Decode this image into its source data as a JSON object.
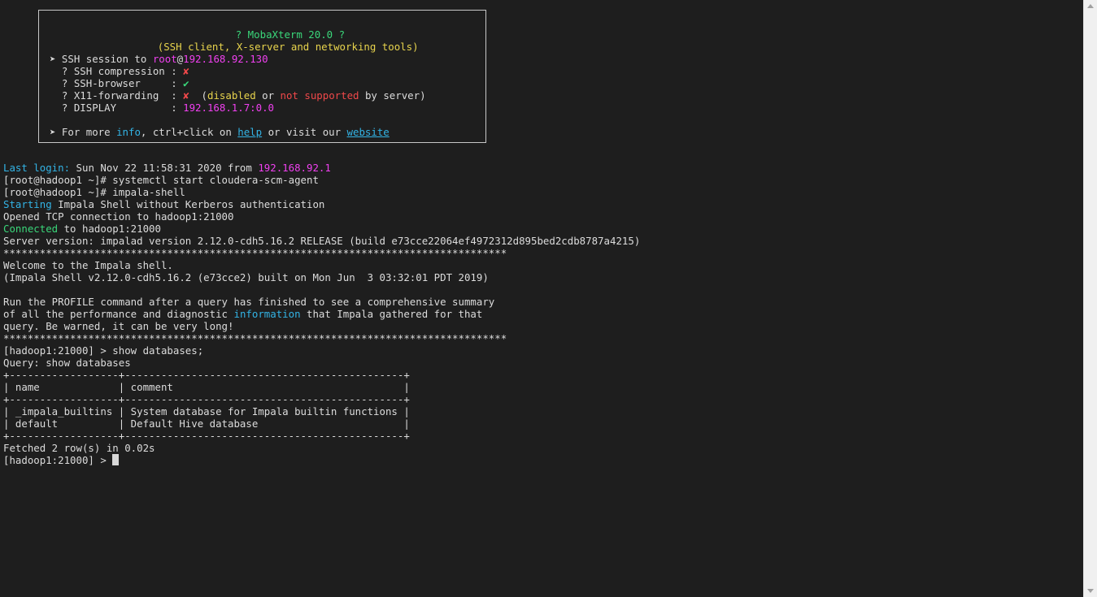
{
  "banner": {
    "title": "? MobaXterm 20.0 ?",
    "subtitle": "(SSH client, X-server and networking tools)",
    "session_prefix": "➤ SSH session to ",
    "session_user": "root",
    "session_at": "@",
    "session_host": "192.168.92.130",
    "compression_label": "  ? SSH compression : ",
    "compression_status": "✘",
    "browser_label": "  ? SSH-browser     : ",
    "browser_status": "✔",
    "x11_label": "  ? X11-forwarding  : ",
    "x11_status": "✘",
    "x11_open": "  (",
    "x11_disabled": "disabled",
    "x11_or": " or ",
    "x11_not_supported": "not supported",
    "x11_close": " by server)",
    "display_label": "  ? DISPLAY         : ",
    "display_value": "192.168.1.7:0.0",
    "more_prefix": "➤ For more ",
    "more_info": "info",
    "more_mid": ", ctrl+click on ",
    "more_help": "help",
    "more_visit": " or visit our ",
    "more_website": "website"
  },
  "terminal": {
    "last_login_label": "Last login:",
    "last_login_date": " Sun Nov 22 11:58:31 2020 from ",
    "last_login_ip": "192.168.92.1",
    "cmd1": "[root@hadoop1 ~]# systemctl start cloudera-scm-agent",
    "cmd2": "[root@hadoop1 ~]# impala-shell",
    "starting_word": "Starting",
    "starting_rest": " Impala Shell without Kerberos authentication",
    "opened": "Opened TCP connection to hadoop1:21000",
    "connected_word": "Connected",
    "connected_rest": " to hadoop1:21000",
    "server_version": "Server version: impalad version 2.12.0-cdh5.16.2 RELEASE (build e73cce22064ef4972312d895bed2cdb8787a4215)",
    "stars": "***********************************************************************************",
    "welcome": "Welcome to the Impala shell.",
    "shell_version": "(Impala Shell v2.12.0-cdh5.16.2 (e73cce2) built on Mon Jun  3 03:32:01 PDT 2019)",
    "profile1": "Run the PROFILE command after a query has finished to see a comprehensive summary",
    "profile2_pre": "of all the performance and diagnostic ",
    "profile2_info": "information",
    "profile2_post": " that Impala gathered for that",
    "profile3": "query. Be warned, it can be very long!",
    "query_cmd": "[hadoop1:21000] > show databases;",
    "query_echo": "Query: show databases",
    "table_border": "+------------------+----------------------------------------------+",
    "table_header": "| name             | comment                                      |",
    "table_row1": "| _impala_builtins | System database for Impala builtin functions |",
    "table_row2": "| default          | Default Hive database                        |",
    "fetched": "Fetched 2 row(s) in 0.02s",
    "prompt": "[hadoop1:21000] > "
  }
}
